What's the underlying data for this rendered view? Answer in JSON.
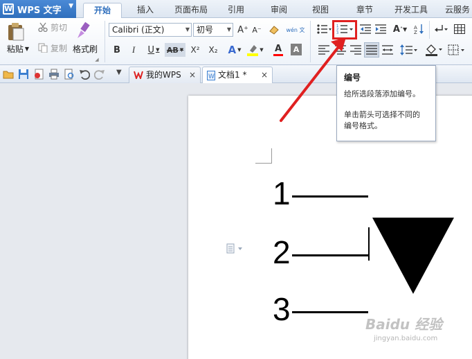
{
  "app": {
    "title": "WPS 文字"
  },
  "menu": {
    "tabs": [
      "开始",
      "插入",
      "页面布局",
      "引用",
      "审阅",
      "视图",
      "章节",
      "开发工具",
      "云服务"
    ]
  },
  "ribbon": {
    "clipboard": {
      "paste": "粘贴",
      "cut": "剪切",
      "copy": "复制",
      "format_painter": "格式刷"
    },
    "font": {
      "name": "Calibri (正文)",
      "size": "初号",
      "phonetic_label": "wén 文"
    },
    "format_letters": {
      "bold": "B",
      "italic": "I",
      "underline": "U",
      "strike": "AB",
      "super": "X²",
      "sub": "X₂",
      "font_color": "A",
      "char_shade": "A",
      "text_effect": "A",
      "grow": "A⁺",
      "shrink": "A⁻"
    }
  },
  "doc_tabs": {
    "wps": "我的WPS",
    "doc": "文档1 *"
  },
  "document": {
    "lines": [
      "1",
      "2",
      "3"
    ]
  },
  "tooltip": {
    "title": "编号",
    "line1": "给所选段落添加编号。",
    "line2": "单击箭头可选择不同的",
    "line3": "编号格式。"
  },
  "watermark": {
    "text": "Baidu 经验",
    "url": "jingyan.baidu.com"
  },
  "colors": {
    "accent": "#2f6fbd",
    "annotation": "#e02020",
    "font_color_bar": "#ff0000",
    "highlight_bar": "#ffff00"
  }
}
